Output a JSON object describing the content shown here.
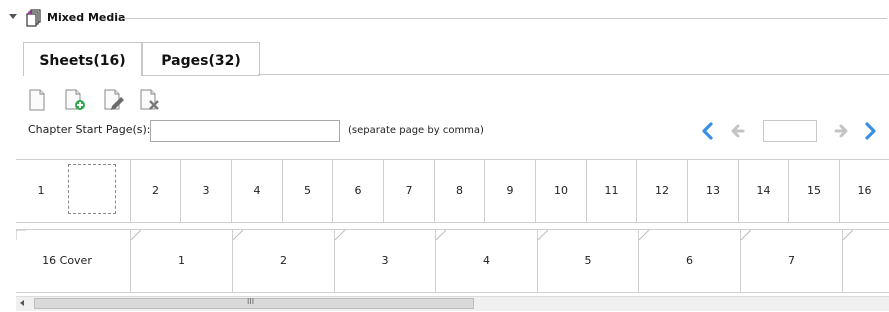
{
  "header": {
    "title": "Mixed Media",
    "icon": "pages-add-icon"
  },
  "tabs": [
    {
      "label": "Sheets(16)"
    },
    {
      "label": "Pages(32)"
    }
  ],
  "toolbar": {
    "buttons": [
      {
        "icon": "blank-page-icon"
      },
      {
        "icon": "add-page-icon"
      },
      {
        "icon": "edit-page-icon"
      },
      {
        "icon": "delete-page-icon"
      }
    ]
  },
  "chapter": {
    "label": "Chapter Start Page(s):",
    "value": "",
    "hint": "(separate page by comma)"
  },
  "navigation": {
    "page_value": ""
  },
  "colors": {
    "accent_blue": "#3a8ee6",
    "disabled_gray": "#c4c4c4",
    "border": "#cfcfcf"
  },
  "sheets": [
    "1",
    "",
    "2",
    "3",
    "4",
    "5",
    "6",
    "7",
    "8",
    "9",
    "10",
    "11",
    "12",
    "13",
    "14",
    "15",
    "16"
  ],
  "pages": [
    "16 Cover",
    "1",
    "2",
    "3",
    "4",
    "5",
    "6",
    "7",
    ""
  ],
  "scrollbar": {
    "grip": "III"
  }
}
